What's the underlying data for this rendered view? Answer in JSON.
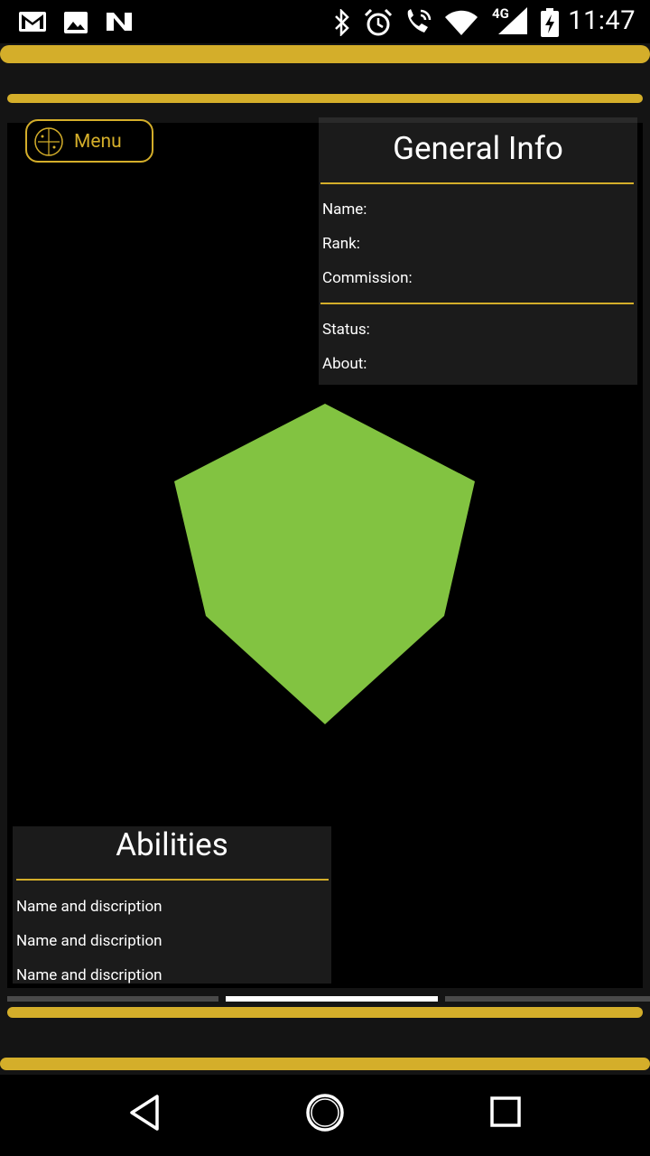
{
  "status_bar": {
    "time": "11:47",
    "network_label": "4G",
    "icons": [
      "gmail-icon",
      "gallery-icon",
      "n-icon",
      "bluetooth-icon",
      "alarm-icon",
      "call-icon",
      "wifi-icon",
      "signal-icon",
      "battery-icon"
    ]
  },
  "menu": {
    "label": "Menu",
    "icon": "crosshair-icon"
  },
  "general_info": {
    "title": "General Info",
    "fields": [
      "Name:",
      "Rank:",
      "Commission:"
    ],
    "extra_fields": [
      "Status:",
      "About:"
    ]
  },
  "model": {
    "shape": "cube",
    "color": "#82c341"
  },
  "abilities": {
    "title": "Abilities",
    "items": [
      "Name and discription",
      "Name and discription",
      "Name and discription"
    ]
  },
  "tabs": {
    "count": 3,
    "active_index": 1
  },
  "colors": {
    "accent": "#d4ae2a",
    "panel": "#1b1b1b",
    "frame": "#141414",
    "background": "#000000"
  },
  "navigation": {
    "buttons": [
      "back-icon",
      "home-icon",
      "recents-icon"
    ]
  }
}
